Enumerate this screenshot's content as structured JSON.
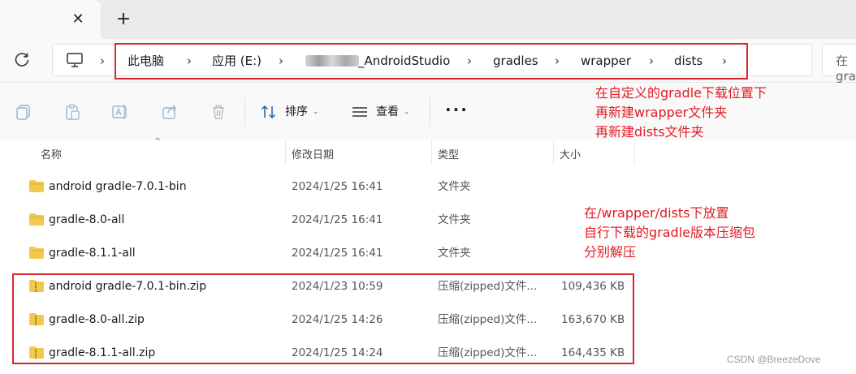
{
  "tabs": {
    "close_symbol": "✕",
    "new_tab_symbol": "+"
  },
  "address_bar": {
    "segments": [
      "此电脑",
      "应用 (E:)",
      "_AndroidStudio",
      "gradles",
      "wrapper",
      "dists"
    ],
    "separator": "›",
    "search_placeholder": "在 gradles 中搜索"
  },
  "toolbar": {
    "sort_label": "排序",
    "view_label": "查看",
    "more_label": "···"
  },
  "columns": {
    "name": "名称",
    "date": "修改日期",
    "type": "类型",
    "size": "大小"
  },
  "files": [
    {
      "name": "android gradle-7.0.1-bin",
      "date": "2024/1/25 16:41",
      "type": "文件夹",
      "size": "",
      "kind": "folder"
    },
    {
      "name": "gradle-8.0-all",
      "date": "2024/1/25 16:41",
      "type": "文件夹",
      "size": "",
      "kind": "folder"
    },
    {
      "name": "gradle-8.1.1-all",
      "date": "2024/1/25 16:41",
      "type": "文件夹",
      "size": "",
      "kind": "folder"
    },
    {
      "name": "android gradle-7.0.1-bin.zip",
      "date": "2024/1/23 10:59",
      "type": "压缩(zipped)文件...",
      "size": "109,436 KB",
      "kind": "zip"
    },
    {
      "name": "gradle-8.0-all.zip",
      "date": "2024/1/25 14:26",
      "type": "压缩(zipped)文件...",
      "size": "163,670 KB",
      "kind": "zip"
    },
    {
      "name": "gradle-8.1.1-all.zip",
      "date": "2024/1/25 14:24",
      "type": "压缩(zipped)文件...",
      "size": "164,435 KB",
      "kind": "zip"
    }
  ],
  "annotations": {
    "note1": [
      "在自定义的gradle下载位置下",
      "再新建wrapper文件夹",
      "再新建dists文件夹"
    ],
    "note2": [
      "在/wrapper/dists下放置",
      "自行下载的gradle版本压缩包",
      "分别解压"
    ]
  },
  "watermark": "CSDN @BreezeDove",
  "colors": {
    "highlight_red": "#d7282d",
    "annotation_red": "#e31b23",
    "folder_yellow": "#f2c94c"
  }
}
